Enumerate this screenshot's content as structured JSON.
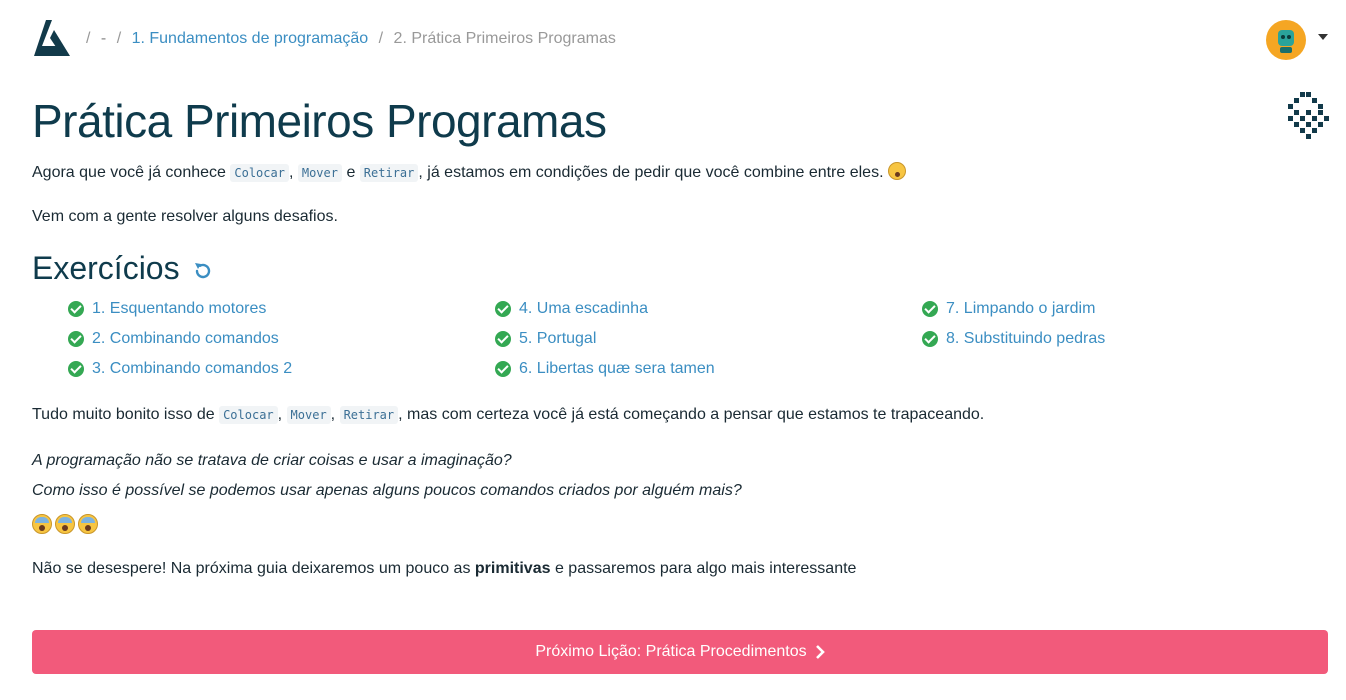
{
  "breadcrumb": {
    "dash": "-",
    "section": "1. Fundamentos de programação",
    "current": "2. Prática Primeiros Programas"
  },
  "title": "Prática Primeiros Programas",
  "intro": {
    "before": "Agora que você já conhece",
    "cmd1": "Colocar",
    "comma": ",",
    "cmd2": "Mover",
    "and": "e",
    "cmd3": "Retirar",
    "after": ", já estamos em condições de pedir que você combine entre eles."
  },
  "invite": "Vem com a gente resolver alguns desafios.",
  "exercises_heading": "Exercícios",
  "exercises": [
    {
      "label": "1. Esquentando motores"
    },
    {
      "label": "2. Combinando comandos"
    },
    {
      "label": "3. Combinando comandos 2"
    },
    {
      "label": "4. Uma escadinha"
    },
    {
      "label": "5. Portugal"
    },
    {
      "label": "6. Libertas quæ sera tamen"
    },
    {
      "label": "7. Limpando o jardim"
    },
    {
      "label": "8. Substituindo pedras"
    }
  ],
  "outro": {
    "before": "Tudo muito bonito isso de",
    "cmd1": "Colocar",
    "cmd2": "Mover",
    "cmd3": "Retirar",
    "after": ", mas com certeza você já está começando a pensar que estamos te trapaceando."
  },
  "question1": "A programação não se tratava de criar coisas e usar a imaginação?",
  "question2": "Como isso é possível se podemos usar apenas alguns poucos comandos criados por alguém mais?",
  "final": {
    "before": "Não se desespere! Na próxima guia deixaremos um pouco as",
    "bold": "primitivas",
    "after": "e passaremos para algo mais interessante"
  },
  "next_button": "Próximo Lição: Prática Procedimentos",
  "colors": {
    "accent": "#3b8ec2",
    "button": "#f25a7b",
    "check": "#34a853",
    "title": "#0f3b4c"
  }
}
